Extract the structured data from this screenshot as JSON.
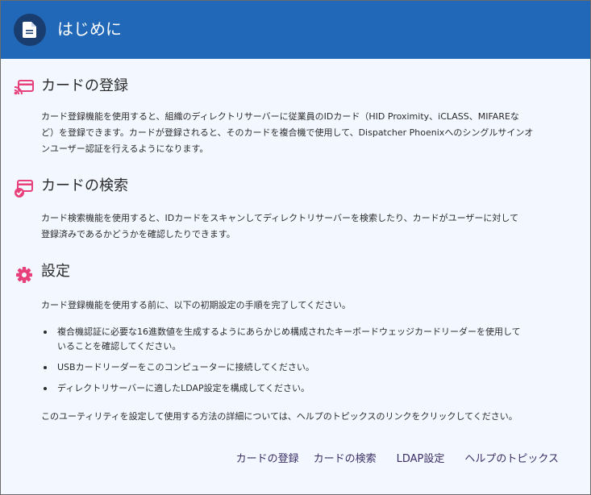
{
  "header": {
    "title": "はじめに"
  },
  "colors": {
    "header_bg": "#2168b8",
    "icon_bg": "#183d6e",
    "accent": "#e8407a"
  },
  "sections": [
    {
      "icon": "card-register-icon",
      "title": "カードの登録",
      "lines": [
        "カード登録機能を使用すると、組織のディレクトリサーバーに従業員のIDカード（HID Proximity、iCLASS、MIFAREな",
        "ど）を登録できます。カードが登録されると、そのカードを複合機で使用して、Dispatcher Phoenixへのシングルサインオ",
        "ンユーザー認証を行えるようになります。"
      ]
    },
    {
      "icon": "card-search-icon",
      "title": "カードの検索",
      "lines": [
        "カード検索機能を使用すると、IDカードをスキャンしてディレクトリサーバーを検索したり、カードがユーザーに対して",
        "登録済みであるかどうかを確認したりできます。"
      ]
    },
    {
      "icon": "gear-icon",
      "title": "設定",
      "intro": "カード登録機能を使用する前に、以下の初期設定の手順を完了してください。",
      "bullets": [
        [
          "複合機認証に必要な16進数値を生成するようにあらかじめ構成されたキーボードウェッジカードリーダーを使用して",
          "いることを確認してください。"
        ],
        [
          "USBカードリーダーをこのコンピューターに接続してください。"
        ],
        [
          "ディレクトリサーバーに適したLDAP設定を構成してください。"
        ]
      ],
      "outro": "このユーティリティを設定して使用する方法の詳細については、ヘルプのトピックスのリンクをクリックしてください。"
    }
  ],
  "footer": {
    "links": [
      "カードの登録",
      "カードの検索",
      "LDAP設定",
      "ヘルプのトピックス"
    ]
  }
}
